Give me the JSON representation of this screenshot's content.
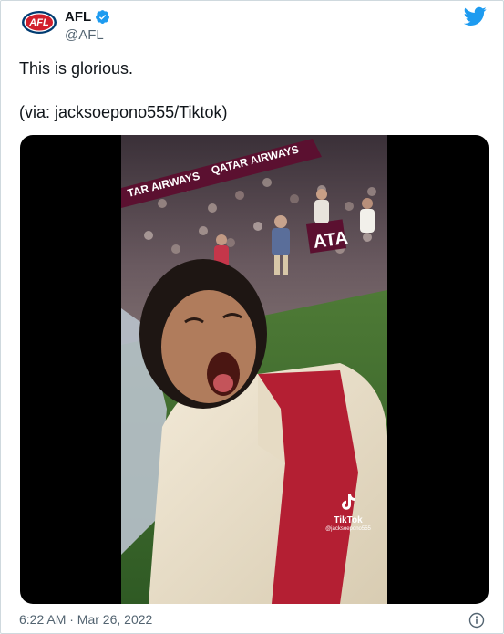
{
  "account": {
    "display_name": "AFL",
    "handle": "@AFL",
    "logo_text": "AFL",
    "verified_icon": "verified-badge-icon",
    "brand_color": "#1d9bf0"
  },
  "tweet": {
    "lines": [
      "This is glorious.",
      "(via: jacksoepono555/Tiktok)"
    ]
  },
  "media": {
    "banner_text_1": "QATAR AIRWAYS",
    "banner_text_2": "TAR AIRWAYS",
    "banner_text_3": "ATA",
    "watermark_label": "TikTok",
    "watermark_user": "@jacksoepono555"
  },
  "footer": {
    "timestamp": "6:22 AM · Mar 26, 2022",
    "info_icon": "info-icon"
  },
  "colors": {
    "text": "#0f1419",
    "secondary_text": "#536471",
    "border": "#cfd9de",
    "twitter_blue": "#1d9bf0",
    "afl_navy": "#003b71",
    "afl_red": "#d11f2c"
  }
}
